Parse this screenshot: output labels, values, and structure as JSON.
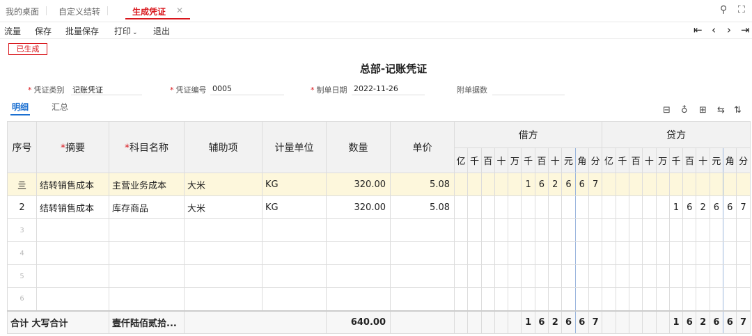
{
  "tabs": [
    {
      "label": "我的桌面"
    },
    {
      "label": "自定义结转"
    },
    {
      "label": "生成凭证"
    }
  ],
  "toolbar": {
    "items": [
      "流量",
      "保存",
      "批量保存",
      "打印",
      "退出"
    ]
  },
  "status_badge": "已生成",
  "title": "总部-记账凭证",
  "fields": {
    "voucher_type_label": "凭证类别",
    "voucher_type_value": "记账凭证",
    "voucher_no_label": "凭证编号",
    "voucher_no_value": "0005",
    "date_label": "制单日期",
    "date_value": "2022-11-26",
    "attachments_label": "附单据数"
  },
  "subtabs": [
    "明细",
    "汇总"
  ],
  "table": {
    "headers": {
      "seq": "序号",
      "summary": "摘要",
      "account": "科目名称",
      "aux": "辅助项",
      "unit": "计量单位",
      "qty": "数量",
      "price": "单价",
      "debit": "借方",
      "credit": "贷方"
    },
    "digits": [
      "亿",
      "千",
      "百",
      "十",
      "万",
      "千",
      "百",
      "十",
      "元",
      "角",
      "分"
    ],
    "rows": [
      {
        "seq": "亖",
        "summary": "结转销售成本",
        "account": "主营业务成本",
        "aux": "大米",
        "unit": "KG",
        "qty": "320.00",
        "price": "5.08",
        "debit": [
          "",
          "",
          "",
          "",
          "",
          "1",
          "6",
          "2",
          "6",
          "6",
          "7"
        ],
        "credit": [
          "",
          "",
          "",
          "",
          "",
          "",
          "",
          "",
          "",
          "",
          ""
        ]
      },
      {
        "seq": "2",
        "summary": "结转销售成本",
        "account": "库存商品",
        "aux": "大米",
        "unit": "KG",
        "qty": "320.00",
        "price": "5.08",
        "debit": [
          "",
          "",
          "",
          "",
          "",
          "",
          "",
          "",
          "",
          "",
          ""
        ],
        "credit": [
          "",
          "",
          "",
          "",
          "",
          "1",
          "6",
          "2",
          "6",
          "6",
          "7"
        ]
      },
      {
        "seq": "3"
      },
      {
        "seq": "4"
      },
      {
        "seq": "5"
      },
      {
        "seq": "6"
      }
    ],
    "total": {
      "label": "合计",
      "caps_label": "大写合计",
      "caps_value": "壹仟陆佰贰拾...",
      "qty": "640.00",
      "debit": [
        "",
        "",
        "",
        "",
        "",
        "1",
        "6",
        "2",
        "6",
        "6",
        "7"
      ],
      "credit": [
        "",
        "",
        "",
        "",
        "",
        "1",
        "6",
        "2",
        "6",
        "6",
        "7"
      ]
    }
  }
}
